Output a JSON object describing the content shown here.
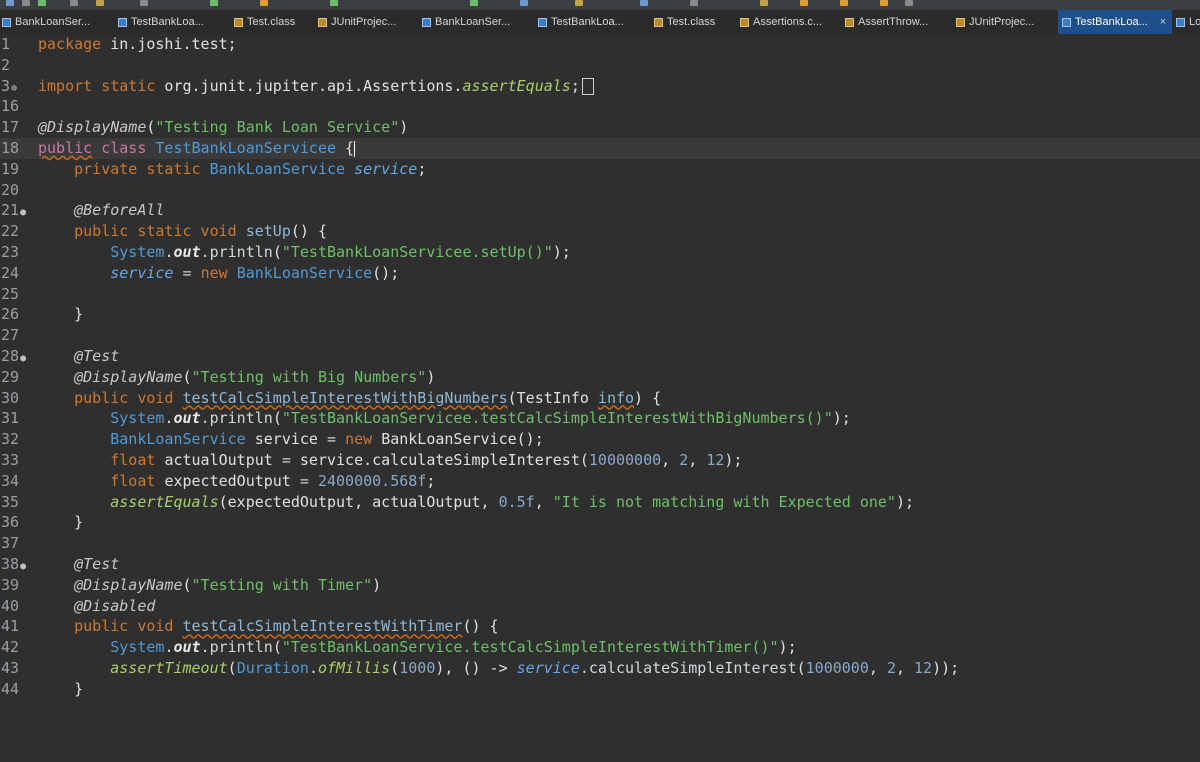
{
  "tabs": [
    {
      "label": "BankLoanSer...",
      "icon": "java-file-icon"
    },
    {
      "label": "TestBankLoa...",
      "icon": "java-file-icon"
    },
    {
      "label": "Test.class",
      "icon": "class-file-icon"
    },
    {
      "label": "JUnitProjec...",
      "icon": "class-file-icon"
    },
    {
      "label": "BankLoanSer...",
      "icon": "java-file-icon"
    },
    {
      "label": "TestBankLoa...",
      "icon": "java-file-icon"
    },
    {
      "label": "Test.class",
      "icon": "class-file-icon"
    },
    {
      "label": "Assertions.c...",
      "icon": "class-file-icon"
    },
    {
      "label": "AssertThrow...",
      "icon": "class-file-icon"
    },
    {
      "label": "JUnitProjec...",
      "icon": "class-file-icon"
    },
    {
      "label": "TestBankLoa...",
      "icon": "java-file-icon",
      "active": true,
      "close": "×"
    },
    {
      "label": "Lo",
      "icon": "java-file-icon"
    }
  ],
  "editor": {
    "line_numbers": [
      "1",
      "2",
      "3",
      "16",
      "17",
      "18",
      "19",
      "20",
      "21",
      "22",
      "23",
      "24",
      "25",
      "26",
      "27",
      "28",
      "29",
      "30",
      "31",
      "32",
      "33",
      "34",
      "35",
      "36",
      "37",
      "38",
      "39",
      "40",
      "41",
      "42",
      "43",
      "44"
    ],
    "lines": {
      "l1": {
        "kw": "package",
        "rest": " in.joshi.test;"
      },
      "l3": {
        "kw": "import static",
        "rest": " org.junit.jupiter.api.Assertions.",
        "method": "assertEquals",
        "end": ";"
      },
      "l17": {
        "ann": "@DisplayName",
        "open": "(",
        "str": "\"Testing Bank Loan Service\"",
        "close": ")"
      },
      "l18": {
        "kw1": "public",
        "kw2": "class",
        "cls": "TestBankLoanServicee",
        "rest": " {"
      },
      "l19": {
        "kw": "private static",
        "cls": "BankLoanService",
        "fld": "service",
        "end": ";"
      },
      "l21": {
        "ann": "@BeforeAll"
      },
      "l22": {
        "kw": "public static void",
        "mth": "setUp",
        "rest": "() {"
      },
      "l23": {
        "sys": "System",
        "dot": ".",
        "out": "out",
        "call": ".println",
        "open": "(",
        "str": "\"TestBankLoanServicee.setUp()\"",
        "end": ");"
      },
      "l24": {
        "fld": "service",
        "eq": " = ",
        "kw": "new",
        "cls": "BankLoanService",
        "end": "();"
      },
      "l26": {
        "brace": "}"
      },
      "l28": {
        "ann": "@Test"
      },
      "l29": {
        "ann": "@DisplayName",
        "open": "(",
        "str": "\"Testing with Big Numbers\"",
        "close": ")"
      },
      "l30": {
        "kw": "public void",
        "mth": "testCalcSimpleInterestWithBigNumbers",
        "open": "(",
        "type": "TestInfo",
        "param": "info",
        "end": ") {"
      },
      "l31": {
        "sys": "System",
        "dot": ".",
        "out": "out",
        "call": ".println",
        "open": "(",
        "str": "\"TestBankLoanServicee.testCalcSimpleInterestWithBigNumbers()\"",
        "end": ");"
      },
      "l32": {
        "cls": "BankLoanService",
        "var": "service",
        "eq": " = ",
        "kw": "new",
        "cls2": "BankLoanService",
        "end": "();"
      },
      "l33": {
        "kw": "float",
        "var": "actualOutput",
        "eq": " = ",
        "call": "service.calculateSimpleInterest",
        "open": "(",
        "n1": "10000000",
        "n2": "2",
        "n3": "12",
        "end": ");"
      },
      "l34": {
        "kw": "float",
        "var": "expectedOutput",
        "eq": " = ",
        "num": "2400000.568f",
        "end": ";"
      },
      "l35": {
        "sta": "assertEquals",
        "args": "(expectedOutput, actualOutput, ",
        "num": "0.5f",
        "sep": ", ",
        "str": "\"It is not matching with Expected one\"",
        "end": ");"
      },
      "l36": {
        "brace": "}"
      },
      "l38": {
        "ann": "@Test"
      },
      "l39": {
        "ann": "@DisplayName",
        "open": "(",
        "str": "\"Testing with Timer\"",
        "close": ")"
      },
      "l40": {
        "ann": "@Disabled"
      },
      "l41": {
        "kw": "public void",
        "mth": "testCalcSimpleInterestWithTimer",
        "end": "() {"
      },
      "l42": {
        "sys": "System",
        "dot": ".",
        "out": "out",
        "call": ".println",
        "open": "(",
        "str": "\"TestBankLoanService.testCalcSimpleInterestWithTimer()\"",
        "end": ");"
      },
      "l43": {
        "sta": "assertTimeout",
        "open": "(",
        "cls": "Duration",
        "dot": ".",
        "sta2": "ofMillis",
        "open2": "(",
        "n1": "1000",
        "mid": "), () -> ",
        "fld": "service",
        "call": ".calculateSimpleInterest",
        "open3": "(",
        "n2": "1000000",
        "n3": "2",
        "n4": "12",
        "end": "));"
      },
      "l44": {
        "brace": "}"
      }
    }
  }
}
